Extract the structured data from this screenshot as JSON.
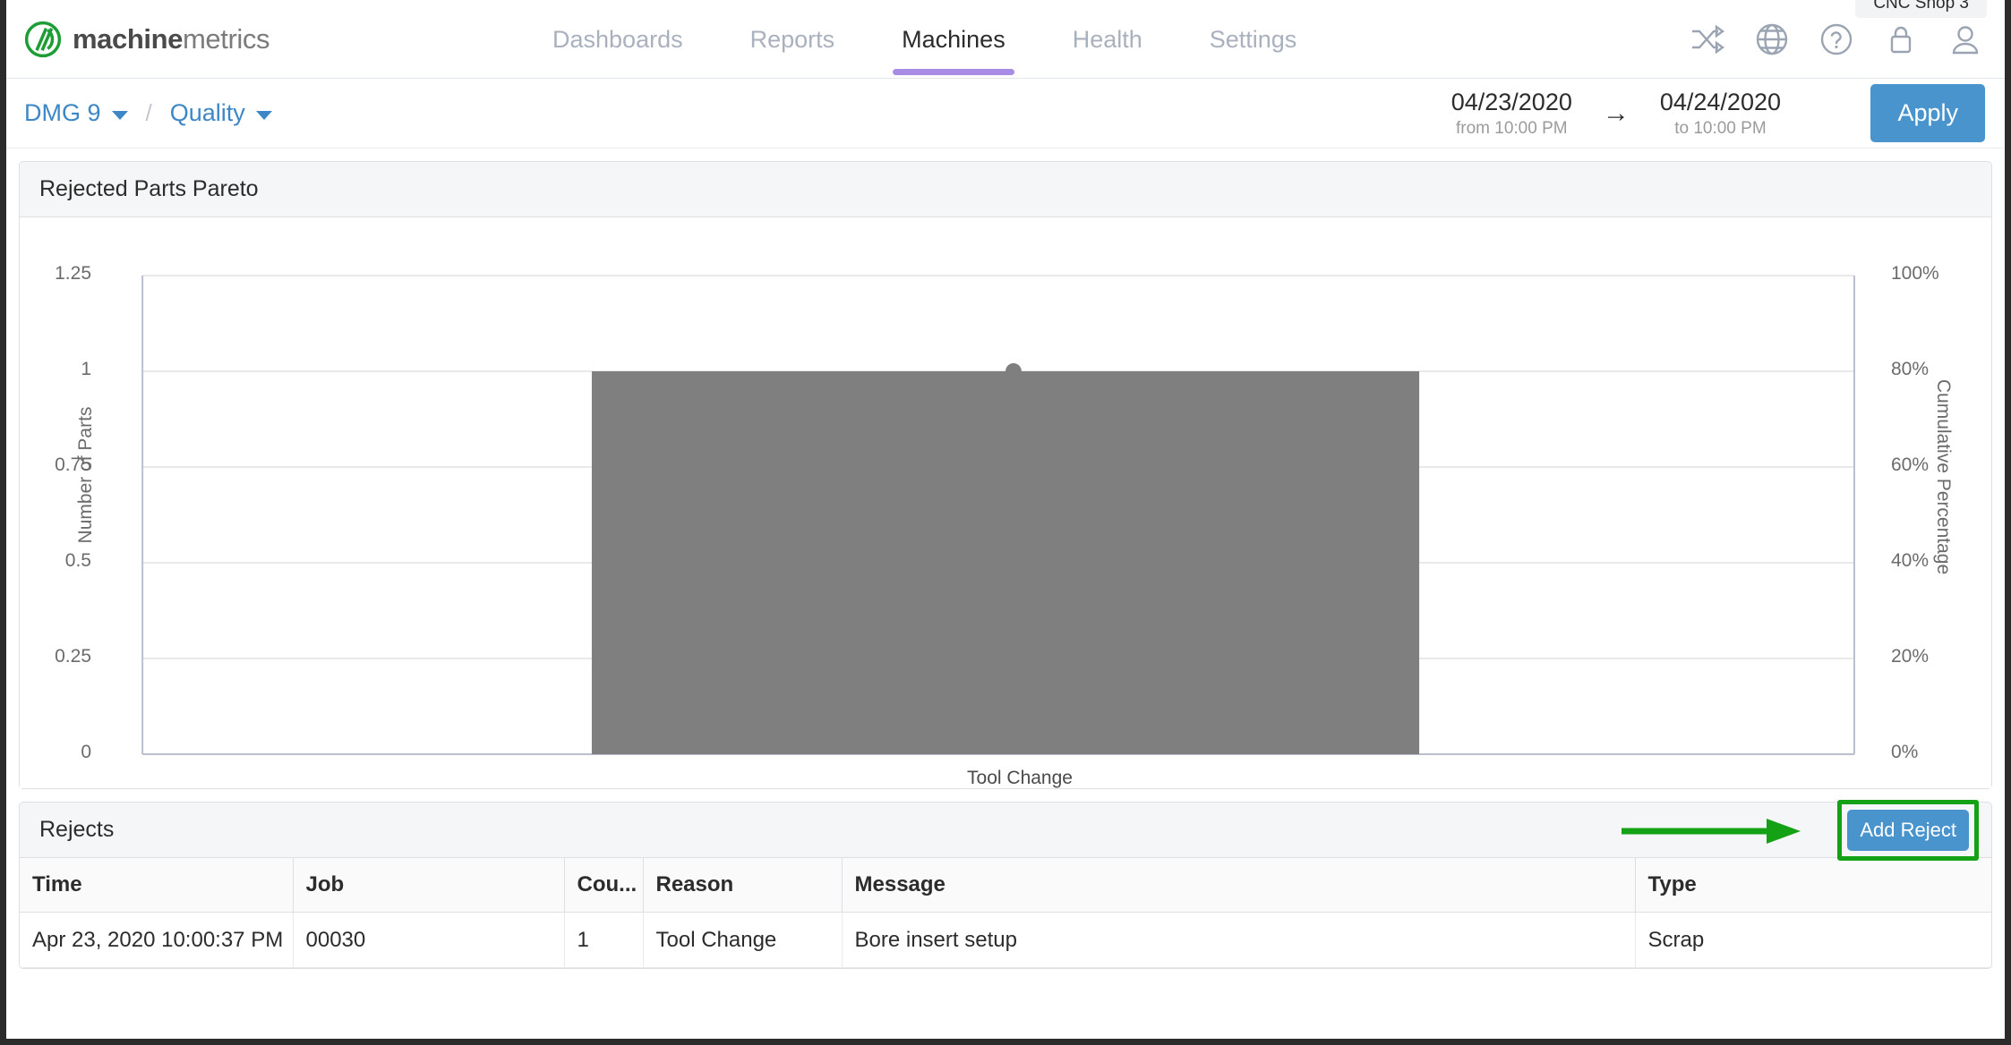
{
  "brand": {
    "bold": "machine",
    "light": "metrics",
    "logo_icon": "machinemetrics-logo-icon"
  },
  "topnav": {
    "links": [
      {
        "label": "Dashboards",
        "active": false
      },
      {
        "label": "Reports",
        "active": false
      },
      {
        "label": "Machines",
        "active": true
      },
      {
        "label": "Health",
        "active": false
      },
      {
        "label": "Settings",
        "active": false
      }
    ],
    "icons": [
      {
        "name": "shuffle-icon"
      },
      {
        "name": "globe-icon"
      },
      {
        "name": "help-icon"
      },
      {
        "name": "lock-icon"
      },
      {
        "name": "user-icon"
      }
    ],
    "tooltip": "CNC Shop 3",
    "active_underline_color": "#a98ce6"
  },
  "subbar": {
    "breadcrumb": {
      "machine": "DMG 9",
      "separator": "/",
      "section": "Quality"
    },
    "date_range": {
      "start_date": "04/23/2020",
      "start_time": "from 10:00 PM",
      "arrow": "→",
      "end_date": "04/24/2020",
      "end_time": "to 10:00 PM"
    },
    "apply_label": "Apply",
    "apply_color": "#4a94cd"
  },
  "chart_card": {
    "title": "Rejected Parts Pareto"
  },
  "chart_data": {
    "type": "bar",
    "title": "Rejected Parts Pareto",
    "categories": [
      "Tool Change"
    ],
    "values": [
      1
    ],
    "ylabel": "Number of Parts",
    "xlabel": "",
    "ylim": [
      0,
      1.25
    ],
    "y_ticks": [
      "0",
      "0.25",
      "0.5",
      "0.75",
      "1",
      "1.25"
    ],
    "y_tick_values": [
      0,
      0.25,
      0.5,
      0.75,
      1,
      1.25
    ],
    "secondary": {
      "type": "scatter",
      "name": "Cumulative Percentage",
      "ylabel": "Cumulative Percentage",
      "values": [
        100
      ],
      "ylim": [
        0,
        125
      ],
      "y_ticks": [
        "0%",
        "20%",
        "40%",
        "60%",
        "80%",
        "100%"
      ],
      "y_tick_values": [
        0,
        20,
        40,
        60,
        80,
        100
      ]
    },
    "bar_color": "#7f7f7f",
    "marker_color": "#7f7f7f",
    "grid": true,
    "legend": "none"
  },
  "rejects_card": {
    "title": "Rejects",
    "add_reject_label": "Add Reject",
    "add_reject_color": "#4a94cd",
    "annotation_color": "#15a115",
    "columns": [
      "Time",
      "Job",
      "Cou...",
      "Reason",
      "Message",
      "Type"
    ],
    "rows": [
      {
        "time": "Apr 23, 2020 10:00:37 PM",
        "job": "00030",
        "count": "1",
        "reason": "Tool Change",
        "message": "Bore insert setup",
        "type": "Scrap"
      }
    ]
  }
}
